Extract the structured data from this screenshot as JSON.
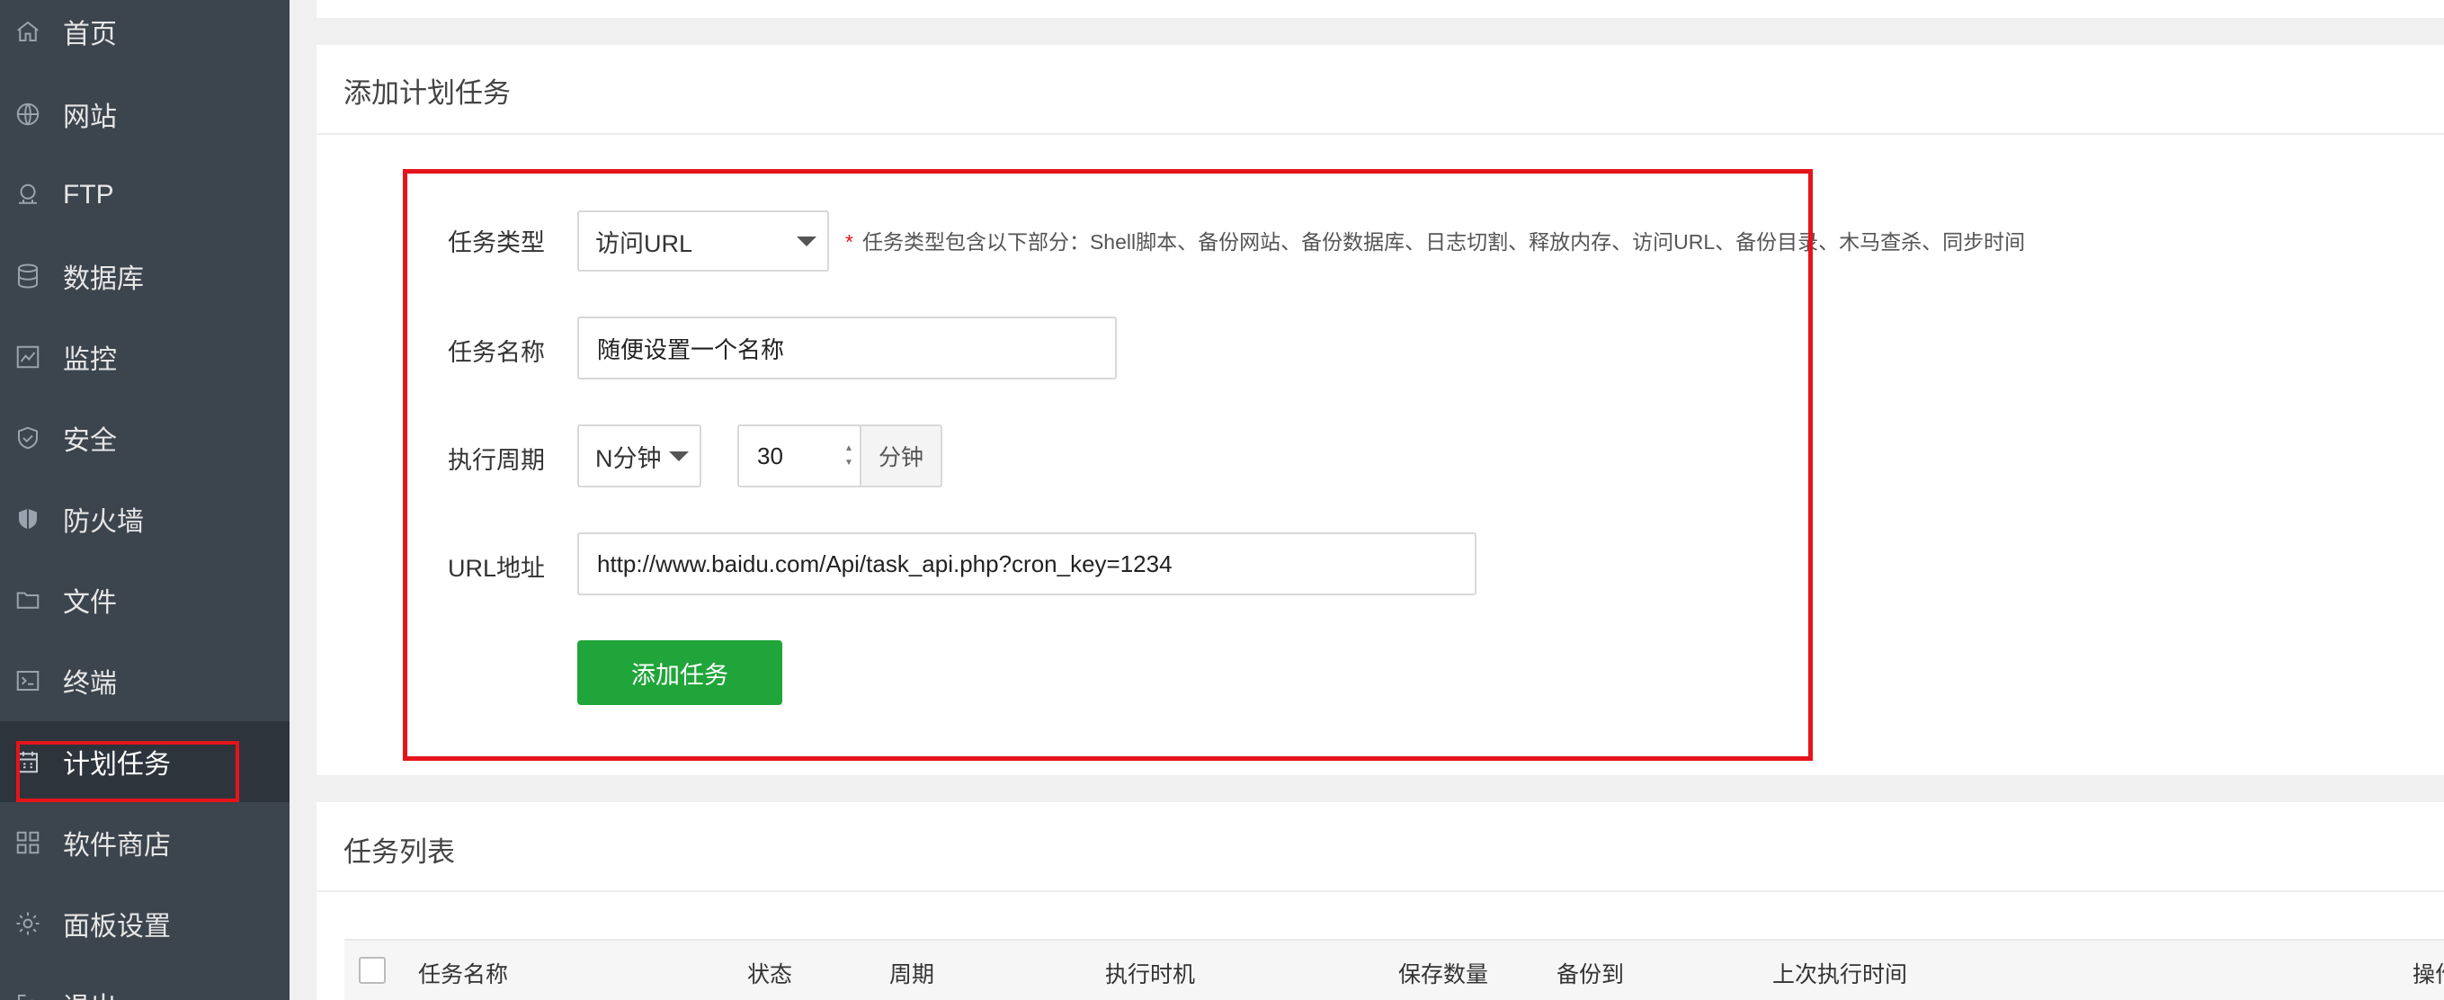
{
  "sidebar": {
    "items": [
      {
        "label": "首页",
        "icon": "home-icon"
      },
      {
        "label": "网站",
        "icon": "globe-icon"
      },
      {
        "label": "FTP",
        "icon": "ftp-icon"
      },
      {
        "label": "数据库",
        "icon": "database-icon"
      },
      {
        "label": "监控",
        "icon": "monitor-icon"
      },
      {
        "label": "安全",
        "icon": "shield-check-icon"
      },
      {
        "label": "防火墙",
        "icon": "firewall-shield-icon"
      },
      {
        "label": "文件",
        "icon": "folder-icon"
      },
      {
        "label": "终端",
        "icon": "terminal-icon"
      },
      {
        "label": "计划任务",
        "icon": "calendar-icon"
      },
      {
        "label": "软件商店",
        "icon": "apps-grid-icon"
      },
      {
        "label": "面板设置",
        "icon": "gear-icon"
      },
      {
        "label": "退出",
        "icon": "logout-icon"
      }
    ],
    "active_index": 9
  },
  "add_task": {
    "title": "添加计划任务",
    "task_type": {
      "label": "任务类型",
      "value": "访问URL",
      "hint_star": "*",
      "hint": "任务类型包含以下部分：Shell脚本、备份网站、备份数据库、日志切割、释放内存、访问URL、备份目录、木马查杀、同步时间"
    },
    "task_name": {
      "label": "任务名称",
      "value": "随便设置一个名称"
    },
    "period": {
      "label": "执行周期",
      "type_value": "N分钟",
      "minutes_value": "30",
      "unit": "分钟"
    },
    "url": {
      "label": "URL地址",
      "value": "http://www.baidu.com/Api/task_api.php?cron_key=1234"
    },
    "submit_label": "添加任务"
  },
  "task_list": {
    "title": "任务列表",
    "columns": [
      "任务名称",
      "状态",
      "周期",
      "执行时机",
      "保存数量",
      "备份到",
      "上次执行时间",
      "操作"
    ]
  },
  "colors": {
    "sidebar_bg": "#3c444d",
    "sidebar_active_bg": "#2d343c",
    "primary_green": "#20a53a",
    "highlight_red": "#e5141b"
  }
}
